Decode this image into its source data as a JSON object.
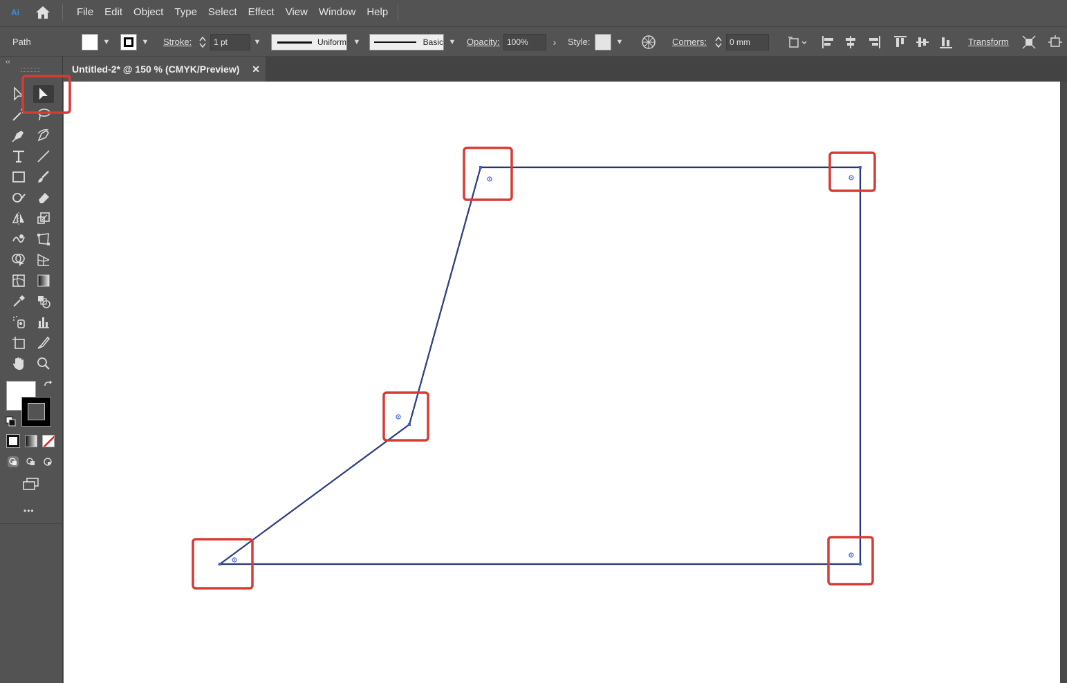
{
  "app": {
    "logo_text": "Ai",
    "menu": [
      "File",
      "Edit",
      "Object",
      "Type",
      "Select",
      "Effect",
      "View",
      "Window",
      "Help"
    ]
  },
  "control_bar": {
    "selection_label": "Path",
    "stroke_label": "Stroke:",
    "stroke_weight": "1 pt",
    "profile_label": "Uniform",
    "brush_label": "Basic",
    "opacity_label": "Opacity:",
    "opacity_value": "100%",
    "style_label": "Style:",
    "corners_label": "Corners:",
    "corners_value": "0 mm",
    "transform_label": "Transform"
  },
  "document": {
    "tab_title": "Untitled-2* @ 150 % (CMYK/Preview)",
    "close_symbol": "✕"
  },
  "toolbar": {
    "more_label": "•••",
    "collapse_symbol": "‹‹"
  },
  "colors": {
    "ui_bg": "#535353",
    "path_stroke": "#1a2357",
    "selection_blue": "#3d5fd6",
    "highlight_red": "#d93a33"
  }
}
